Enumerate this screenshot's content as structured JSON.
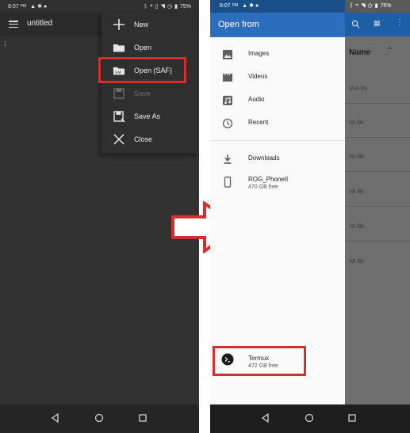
{
  "left_phone": {
    "status": {
      "time": "8:07",
      "ampm": "PM",
      "battery": "75%"
    },
    "toolbar": {
      "title": "untitled"
    },
    "editor": {
      "line_marker": "1"
    },
    "menu": {
      "items": [
        {
          "label": "New",
          "icon": "plus-icon",
          "enabled": true
        },
        {
          "label": "Open",
          "icon": "folder-icon",
          "enabled": true
        },
        {
          "label": "Open (SAF)",
          "icon": "saf-folder-icon",
          "enabled": true
        },
        {
          "label": "Save",
          "icon": "save-icon",
          "enabled": false
        },
        {
          "label": "Save As",
          "icon": "save-as-icon",
          "enabled": true
        },
        {
          "label": "Close",
          "icon": "close-icon",
          "enabled": true
        }
      ]
    }
  },
  "right_phone": {
    "status": {
      "time": "8:07",
      "ampm": "PM",
      "battery": "75%"
    },
    "drawer": {
      "title": "Open from",
      "locations": [
        {
          "label": "Images",
          "icon": "image-icon"
        },
        {
          "label": "Videos",
          "icon": "video-icon"
        },
        {
          "label": "Audio",
          "icon": "audio-icon"
        },
        {
          "label": "Recent",
          "icon": "clock-icon"
        }
      ],
      "storage": [
        {
          "label": "Downloads",
          "sub": "",
          "icon": "download-icon"
        },
        {
          "label": "ROG_PhoneII",
          "sub": "470 GB free",
          "icon": "phone-icon"
        }
      ],
      "provider": {
        "label": "Termux",
        "sub": "472 GB free",
        "icon": "terminal-icon"
      }
    },
    "background": {
      "sort_label": "Name",
      "row_label": "AVA file",
      "row_label_short": "VA file"
    }
  },
  "colors": {
    "accent_blue": "#2a6ebd",
    "highlight_red": "#d32f2f",
    "dark_bg": "#303030"
  }
}
